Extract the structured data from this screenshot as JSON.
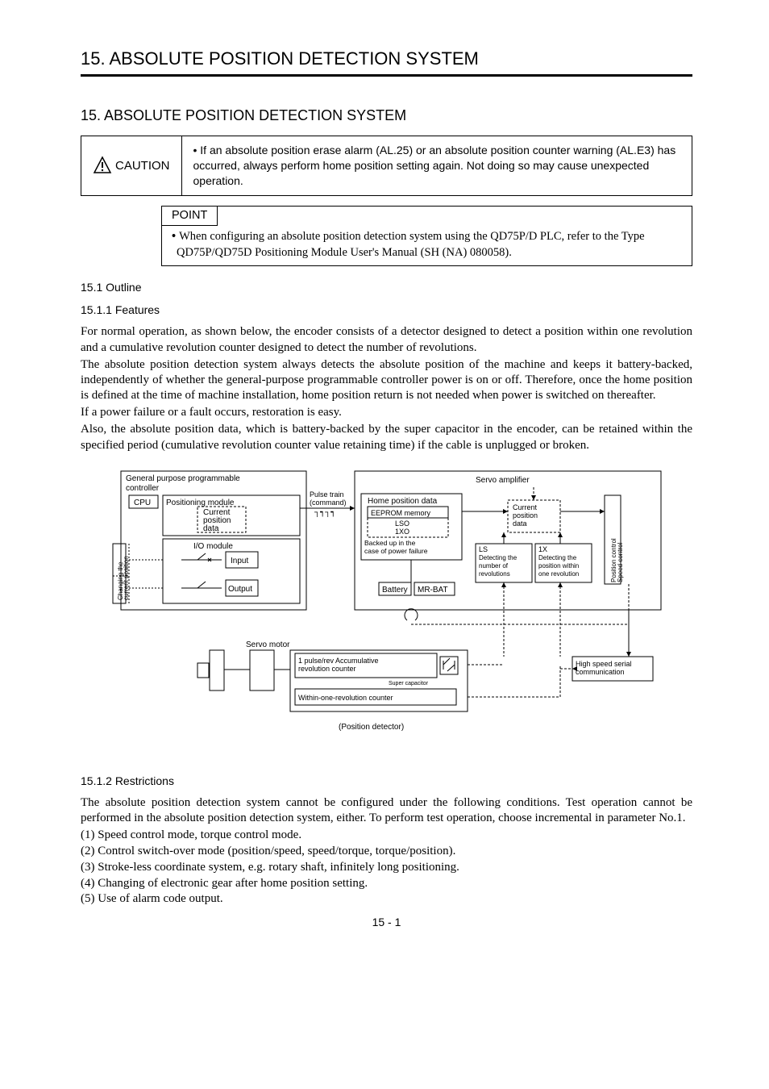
{
  "header": {
    "title": "15. ABSOLUTE POSITION DETECTION SYSTEM"
  },
  "section_title": "15. ABSOLUTE POSITION DETECTION SYSTEM",
  "caution": {
    "label": "CAUTION",
    "text": "If an absolute position erase alarm (AL.25) or an absolute position counter warning (AL.E3) has occurred, always perform home position setting again. Not doing so may cause unexpected operation."
  },
  "point": {
    "label": "POINT",
    "text": "When configuring an absolute position detection system using the QD75P/D PLC, refer to the Type QD75P/QD75D Positioning Module User's Manual (SH (NA) 080058)."
  },
  "outline_heading": "15.1 Outline",
  "features_heading": "15.1.1 Features",
  "features_p1": "For normal operation, as shown below, the encoder consists of a detector designed to detect a position within one revolution and a cumulative revolution counter designed to detect the number of revolutions.",
  "features_p2": "The absolute position detection system always detects the absolute position of the machine and keeps it battery-backed, independently of whether the general-purpose programmable controller power is on or off. Therefore, once the home position is defined at the time of machine installation, home position return is not needed when power is switched on thereafter.",
  "features_p3": "If a power failure or a fault occurs, restoration is easy.",
  "features_p4": "Also, the absolute position data, which is battery-backed by the super capacitor in the encoder, can be retained within the specified period (cumulative revolution counter value retaining time) if the cable is unplugged or broken.",
  "diagram": {
    "plc_label": "General purpose programmable controller",
    "cpu": "CPU",
    "positioning_module": "Positioning module",
    "current_position_data": "Current position data",
    "io_module": "I/O module",
    "input": "Input",
    "output": "Output",
    "changing_label": "Changing the current position data",
    "pulse_train": "Pulse train (command)",
    "servo_amp": "Servo amplifier",
    "home_position": "Home position data",
    "eeprom": "EEPROM memory",
    "lso": "LSO",
    "onexo": "1XO",
    "backed_up": "Backed up in the case of power failure",
    "battery": "Battery",
    "mrbat": "MR-BAT",
    "current_position_data2": "Current position data",
    "ls_detect": "LS Detecting the number of revolutions",
    "onex_detect": "1X Detecting the position within one revolution",
    "pos_speed_control": "Position control Speed control",
    "servo_motor": "Servo motor",
    "acc_counter": "1 pulse/rev Accumulative revolution counter",
    "super_cap": "Super capacitor",
    "within_one": "Within-one-revolution counter",
    "high_speed": "High speed serial communication",
    "position_detector": "(Position detector)"
  },
  "restrictions_heading": "15.1.2 Restrictions",
  "restrictions_intro": "The absolute position detection system cannot be configured under the following conditions. Test operation cannot be performed in the absolute position detection system, either. To perform test operation, choose incremental in parameter No.1.",
  "restrictions": [
    "(1) Speed control mode, torque control mode.",
    "(2) Control switch-over mode (position/speed, speed/torque, torque/position).",
    "(3) Stroke-less coordinate system, e.g. rotary shaft, infinitely long positioning.",
    "(4) Changing of electronic gear after home position setting.",
    "(5) Use of alarm code output."
  ],
  "page_number": "15 -  1"
}
